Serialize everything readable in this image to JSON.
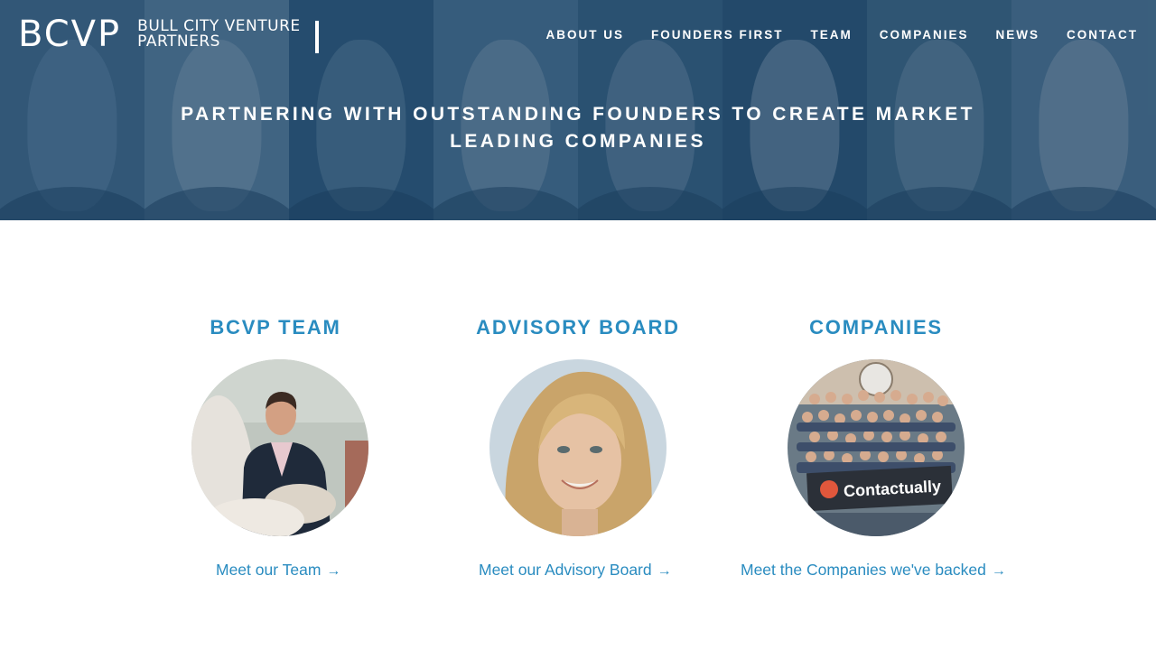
{
  "header": {
    "logo_mark": "BCVP",
    "logo_line1": "BULL CITY VENTURE",
    "logo_line2": "PARTNERS",
    "nav": [
      {
        "label": "ABOUT US"
      },
      {
        "label": "FOUNDERS FIRST"
      },
      {
        "label": "TEAM"
      },
      {
        "label": "COMPANIES"
      },
      {
        "label": "NEWS"
      },
      {
        "label": "CONTACT"
      }
    ]
  },
  "hero": {
    "tagline": "PARTNERING WITH OUTSTANDING FOUNDERS TO CREATE MARKET LEADING COMPANIES"
  },
  "sections": [
    {
      "title": "BCVP TEAM",
      "link": "Meet our Team",
      "arrow": "→"
    },
    {
      "title": "ADVISORY BOARD",
      "link": "Meet our Advisory Board",
      "arrow": "→"
    },
    {
      "title": "COMPANIES",
      "link": "Meet the Companies we've backed",
      "arrow": "→"
    }
  ],
  "photo_banner_text": "Contactually",
  "colors": {
    "accent": "#2a8cc0",
    "hero_overlay": "#1e4669",
    "text_on_hero": "#ffffff"
  }
}
